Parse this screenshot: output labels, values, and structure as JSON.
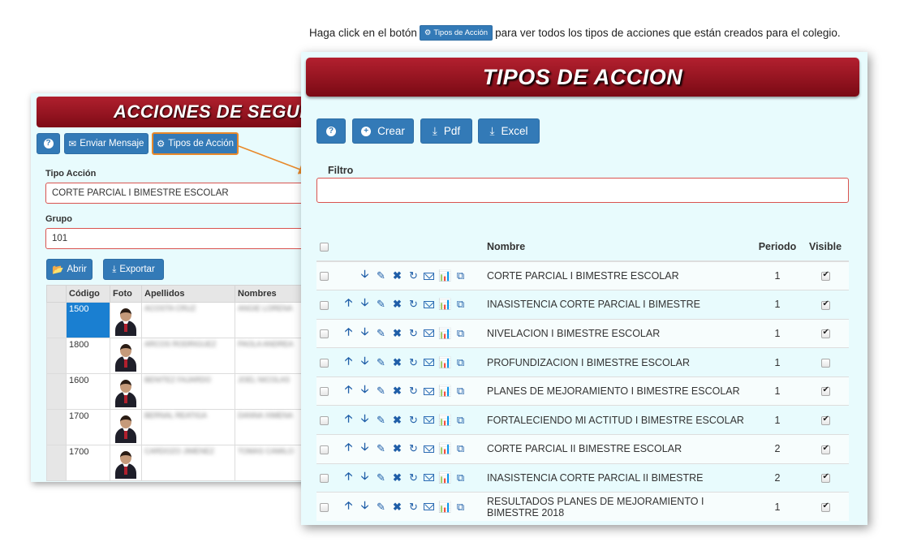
{
  "instruction": {
    "before": "Haga click en el botón",
    "button_label": "Tipos de Acción",
    "after": "para ver todos los tipos de acciones que están creados para el colegio."
  },
  "back_window": {
    "title": "ACCIONES DE SEGUIM",
    "toolbar": {
      "help_label": "?",
      "send_message_label": "Enviar Mensaje",
      "action_types_label": "Tipos de Acción"
    },
    "tipo_accion": {
      "label": "Tipo Acción",
      "value": "CORTE PARCIAL I BIMESTRE ESCOLAR"
    },
    "grupo": {
      "label": "Grupo",
      "value": "101"
    },
    "open_label": "Abrir",
    "export_label": "Exportar",
    "table": {
      "headers": [
        "",
        "Código",
        "Foto",
        "Apellidos",
        "Nombres"
      ],
      "rows": [
        {
          "code": "1500",
          "apellidos": "ACOSTA CRUZ",
          "nombres": "ANGIE LORENA"
        },
        {
          "code": "1800",
          "apellidos": "ARCOS RODRIGUEZ",
          "nombres": "PAOLA ANDREA"
        },
        {
          "code": "1600",
          "apellidos": "BENITEZ FAJARDO",
          "nombres": "JOEL NICOLAS"
        },
        {
          "code": "1700",
          "apellidos": "BERNAL REATIGA",
          "nombres": "DANNA XIMENA"
        },
        {
          "code": "1700",
          "apellidos": "CARDOZO JIMENEZ",
          "nombres": "TOMAS CAMILO"
        }
      ]
    }
  },
  "front_window": {
    "title": "TIPOS DE ACCION",
    "toolbar": {
      "help_label": "?",
      "create_label": "Crear",
      "pdf_label": "Pdf",
      "excel_label": "Excel"
    },
    "filter": {
      "label": "Filtro",
      "value": "",
      "placeholder": ""
    },
    "table": {
      "headers": {
        "nombre": "Nombre",
        "periodo": "Periodo",
        "visible": "Visible"
      },
      "rows": [
        {
          "nombre": "CORTE PARCIAL I BIMESTRE ESCOLAR",
          "periodo": "1",
          "visible": true,
          "up": false
        },
        {
          "nombre": "INASISTENCIA CORTE PARCIAL I BIMESTRE",
          "periodo": "1",
          "visible": true,
          "up": true
        },
        {
          "nombre": "NIVELACION I BIMESTRE ESCOLAR",
          "periodo": "1",
          "visible": true,
          "up": true
        },
        {
          "nombre": "PROFUNDIZACION I BIMESTRE ESCOLAR",
          "periodo": "1",
          "visible": false,
          "up": true
        },
        {
          "nombre": "PLANES DE MEJORAMIENTO I BIMESTRE ESCOLAR",
          "periodo": "1",
          "visible": true,
          "up": true
        },
        {
          "nombre": "FORTALECIENDO MI ACTITUD I BIMESTRE ESCOLAR",
          "periodo": "1",
          "visible": true,
          "up": true
        },
        {
          "nombre": "CORTE PARCIAL II BIMESTRE ESCOLAR",
          "periodo": "2",
          "visible": true,
          "up": true
        },
        {
          "nombre": "INASISTENCIA CORTE PARCIAL II BIMESTRE",
          "periodo": "2",
          "visible": true,
          "up": true
        },
        {
          "nombre": "RESULTADOS PLANES DE MEJORAMIENTO I BIMESTRE 2018",
          "periodo": "1",
          "visible": true,
          "up": true
        }
      ]
    }
  },
  "colors": {
    "title_red": "#8b0f1c",
    "button_blue": "#337ab7",
    "panel_bg": "#e8fbfd",
    "highlight_orange": "#e8892a",
    "error_border": "#d9534f"
  },
  "icons": {
    "row_actions": [
      "arrow-up-icon",
      "arrow-down-icon",
      "pencil-icon",
      "delete-x-icon",
      "refresh-icon",
      "envelope-icon",
      "bar-chart-icon",
      "copy-icon"
    ]
  }
}
